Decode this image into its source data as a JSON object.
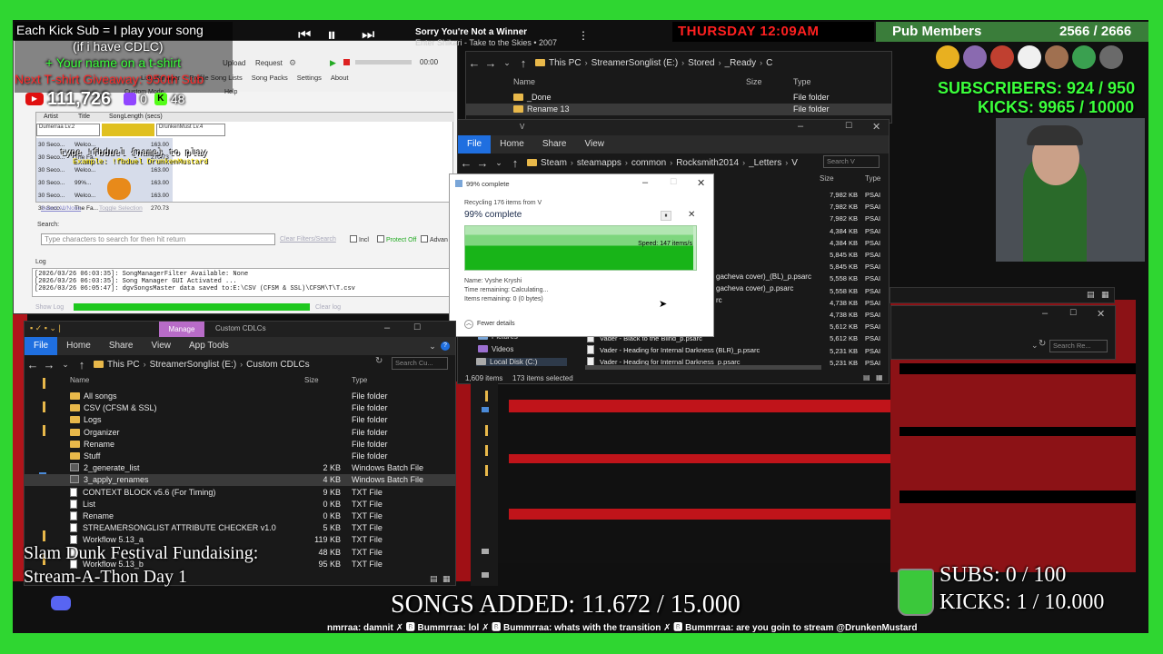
{
  "overlay": {
    "kick_sub_line1": "Each Kick Sub = I play your song",
    "kick_sub_line2": "(if i have CDLC)",
    "kick_sub_line3": "+ Your name on a t-shirt",
    "tshirt_giveaway": "Next T-shirt Giveaway: 950th Sub",
    "youtube_count": "111,726",
    "twitch_count": "0",
    "kick_count": "48",
    "now_playing_title": "Sorry You're Not a Winner",
    "now_playing_artist": "Enter Shikari - Take to the Skies • 2007",
    "clock": "THURSDAY 12:09AM",
    "pub_members_label": "Pub Members",
    "pub_members_count": "2566 / 2666",
    "subscribers_label": "SUBSCRIBERS: 924 / 950",
    "kicks_label": "KICKS: 9965 / 10000",
    "fundraiser_line1": "Slam Dunk Festival Fundaising:",
    "fundraiser_line2": "Stream-A-Thon Day 1",
    "songs_added": "SONGS ADDED: 11.672 / 15.000",
    "subs_goal": "SUBS:  0 / 100",
    "kicks_goal": "KICKS: 1 / 10.000",
    "chat_ticker": "nmrraa: damnit  ✗ 🅱 Bummrraa: lol  ✗ 🅱 Bummrraa: whats with the transition  ✗ 🅱 Bummrraa: are you goin to stream @DrunkenMustard",
    "type_fbduel_line1": "type !fbduel {name} to play",
    "type_fbduel_line2": "Example: !fbduel DrunkenMustard",
    "accent_green": "#2fd631",
    "accent_red": "#ff2a2a"
  },
  "songmanager": {
    "menu": [
      "Upload",
      "Request",
      "00:00"
    ],
    "tabs": [
      "List Manager",
      "Profile Song Lists",
      "Song Packs",
      "Settings",
      "About"
    ],
    "custom_mode": "Custom Mode",
    "help": "Help",
    "table_headers": [
      "Artist",
      "Title",
      "SongLength (secs)"
    ],
    "header_artists": [
      "Dumerraa  Lv.2",
      "DrunkenMust  Lv.4"
    ],
    "rows": [
      {
        "col1": "30 Seco...",
        "col2": "Welco...",
        "col3": "163.00"
      },
      {
        "col1": "30 Seco...",
        "col2": "The Fa...",
        "col3": "270.73"
      },
      {
        "col1": "30 Seco...",
        "col2": "Welco...",
        "col3": "163.00"
      },
      {
        "col1": "30 Seco...",
        "col2": "99%...",
        "col3": "163.00"
      },
      {
        "col1": "30 Seco...",
        "col2": "Welco...",
        "col3": "163.00"
      },
      {
        "col1": "30 Seco...",
        "col2": "The Fa...",
        "col3": "270.73"
      }
    ],
    "select_all": "Select All/None",
    "toggle_selection": "Toggle Selection",
    "search_label": "Search:",
    "search_placeholder": "Type characters to search for then hit return",
    "clear_filters": "Clear Filters/Search",
    "include_label": "Incl",
    "protect_label": "Protect Off",
    "advanced_label": "Advan",
    "log_label": "Log",
    "log_lines": [
      "[2026/03/26 06:03:35]: SongManagerFilter Available: None",
      "[2026/03/26 06:03:35]: Song Manager GUI Activated ...",
      "[2026/03/26 06:05:47]: dgvSongsMaster data saved to:E:\\CSV (CFSM & SSL)\\CFSM\\T\\T.csv"
    ],
    "show_log": "Show Log",
    "clear_log": "Clear log"
  },
  "explorer_top": {
    "crumbs": [
      "This PC",
      "StreamerSonglist (E:)",
      "Stored",
      "_Ready",
      "C"
    ],
    "headers": [
      "Name",
      "Size",
      "Type"
    ],
    "rows": [
      {
        "name": "_Done",
        "type": "File folder"
      },
      {
        "name": "Rename 13",
        "type": "File folder"
      }
    ]
  },
  "explorer_letters": {
    "title": "V",
    "tabs": [
      "File",
      "Home",
      "Share",
      "View"
    ],
    "crumbs": [
      "Steam",
      "steamapps",
      "common",
      "Rocksmith2014",
      "_Letters",
      "V"
    ],
    "search_placeholder": "Search V",
    "headers": [
      "Size",
      "Type"
    ],
    "sizes": [
      "7,982 KB",
      "7,982 KB",
      "7,982 KB",
      "4,384 KB",
      "4,384 KB",
      "5,845 KB",
      "5,845 KB",
      "5,558 KB",
      "5,558 KB",
      "4,738 KB",
      "4,738 KB",
      "5,612 KB",
      "5,612 KB",
      "5,231 KB",
      "5,231 KB"
    ],
    "type_abbr": "PSAI",
    "partial_names": [
      "gacheva cover)_(BL)_p.psarc",
      "gacheva cover)_p.psarc",
      "rc"
    ],
    "visible_rows": [
      {
        "name": "Vader - Black to the Blind_p.psarc"
      },
      {
        "name": "Vader - Heading for Internal Darkness (BLR)_p.psarc"
      },
      {
        "name": "Vader - Heading for Internal Darkness_p.psarc"
      }
    ],
    "side_items": [
      "Pictures",
      "Videos",
      "Local Disk (C:)"
    ],
    "status_items": "1,609 items",
    "status_selected": "173 items selected"
  },
  "recycle_dialog": {
    "title": "99% complete",
    "subtitle": "Recycling 176 items from V",
    "percent_text": "99% complete",
    "speed": "Speed: 147 items/s",
    "progress_fraction": 0.99,
    "name_line": "Name: Vyshe Kryshi",
    "time_remaining": "Time remaining: Calculating...",
    "items_remaining": "Items remaining: 0 (0 bytes)",
    "fewer_details": "Fewer details"
  },
  "explorer_cdlcs": {
    "manage_tab": "Manage",
    "title": "Custom CDLCs",
    "tabs": [
      "File",
      "Home",
      "Share",
      "View",
      "App Tools"
    ],
    "crumbs": [
      "This PC",
      "StreamerSonglist (E:)",
      "Custom CDLCs"
    ],
    "search_placeholder": "Search Cu...",
    "headers": [
      "Name",
      "Size",
      "Type"
    ],
    "rows": [
      {
        "kind": "folder",
        "name": "All songs",
        "size": "",
        "type": "File folder"
      },
      {
        "kind": "folder",
        "name": "CSV (CFSM & SSL)",
        "size": "",
        "type": "File folder"
      },
      {
        "kind": "folder",
        "name": "Logs",
        "size": "",
        "type": "File folder"
      },
      {
        "kind": "folder",
        "name": "Organizer",
        "size": "",
        "type": "File folder"
      },
      {
        "kind": "folder",
        "name": "Rename",
        "size": "",
        "type": "File folder"
      },
      {
        "kind": "folder",
        "name": "Stuff",
        "size": "",
        "type": "File folder"
      },
      {
        "kind": "bat",
        "name": "2_generate_list",
        "size": "2 KB",
        "type": "Windows Batch File"
      },
      {
        "kind": "bat",
        "name": "3_apply_renames",
        "size": "4 KB",
        "type": "Windows Batch File"
      },
      {
        "kind": "txt",
        "name": "CONTEXT BLOCK v5.6 (For Timing)",
        "size": "9 KB",
        "type": "TXT File"
      },
      {
        "kind": "txt",
        "name": "List",
        "size": "0 KB",
        "type": "TXT File"
      },
      {
        "kind": "txt",
        "name": "Rename",
        "size": "0 KB",
        "type": "TXT File"
      },
      {
        "kind": "txt",
        "name": "STREAMERSONGLIST ATTRIBUTE CHECKER v1.0",
        "size": "5 KB",
        "type": "TXT File"
      },
      {
        "kind": "txt",
        "name": "Workflow 5.13_a",
        "size": "119 KB",
        "type": "TXT File"
      },
      {
        "kind": "txt",
        "name": "",
        "size": "48 KB",
        "type": "TXT File"
      },
      {
        "kind": "txt",
        "name": "Workflow 5.13_b",
        "size": "95 KB",
        "type": "TXT File"
      }
    ]
  },
  "explorer_right_bottom": {
    "search_placeholder": "Search Re..."
  }
}
